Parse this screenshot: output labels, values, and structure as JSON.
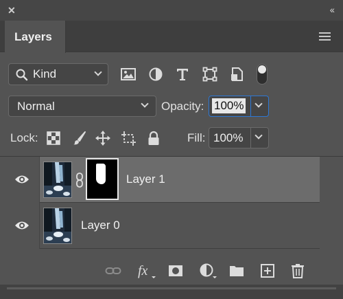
{
  "window": {
    "close_glyph": "✕",
    "collapse_glyph": "‹‹"
  },
  "tabs": [
    {
      "label": "Layers"
    }
  ],
  "filter": {
    "selected": "Kind",
    "icons": [
      "image-filter-icon",
      "adjustment-filter-icon",
      "type-filter-icon",
      "shape-filter-icon",
      "smart-object-filter-icon"
    ]
  },
  "blend": {
    "mode": "Normal",
    "opacity_label": "Opacity:",
    "opacity_value": "100%"
  },
  "lock": {
    "label": "Lock:",
    "fill_label": "Fill:",
    "fill_value": "100%",
    "icons": [
      "lock-transparent-pixels-icon",
      "lock-image-pixels-icon",
      "lock-position-icon",
      "lock-artboard-icon",
      "lock-all-icon"
    ]
  },
  "layers": [
    {
      "name": "Layer 1",
      "visible": true,
      "selected": true,
      "has_mask": true
    },
    {
      "name": "Layer 0",
      "visible": true,
      "selected": false,
      "has_mask": false
    }
  ],
  "colors": {
    "panel": "#535353",
    "selected_row": "#6c6c6c",
    "focus_outline": "#2d78d6"
  },
  "bottom_icons": [
    "link-layers-icon",
    "fx-icon",
    "add-mask-icon",
    "adjustment-layer-icon",
    "new-group-icon",
    "new-layer-icon",
    "delete-icon"
  ]
}
